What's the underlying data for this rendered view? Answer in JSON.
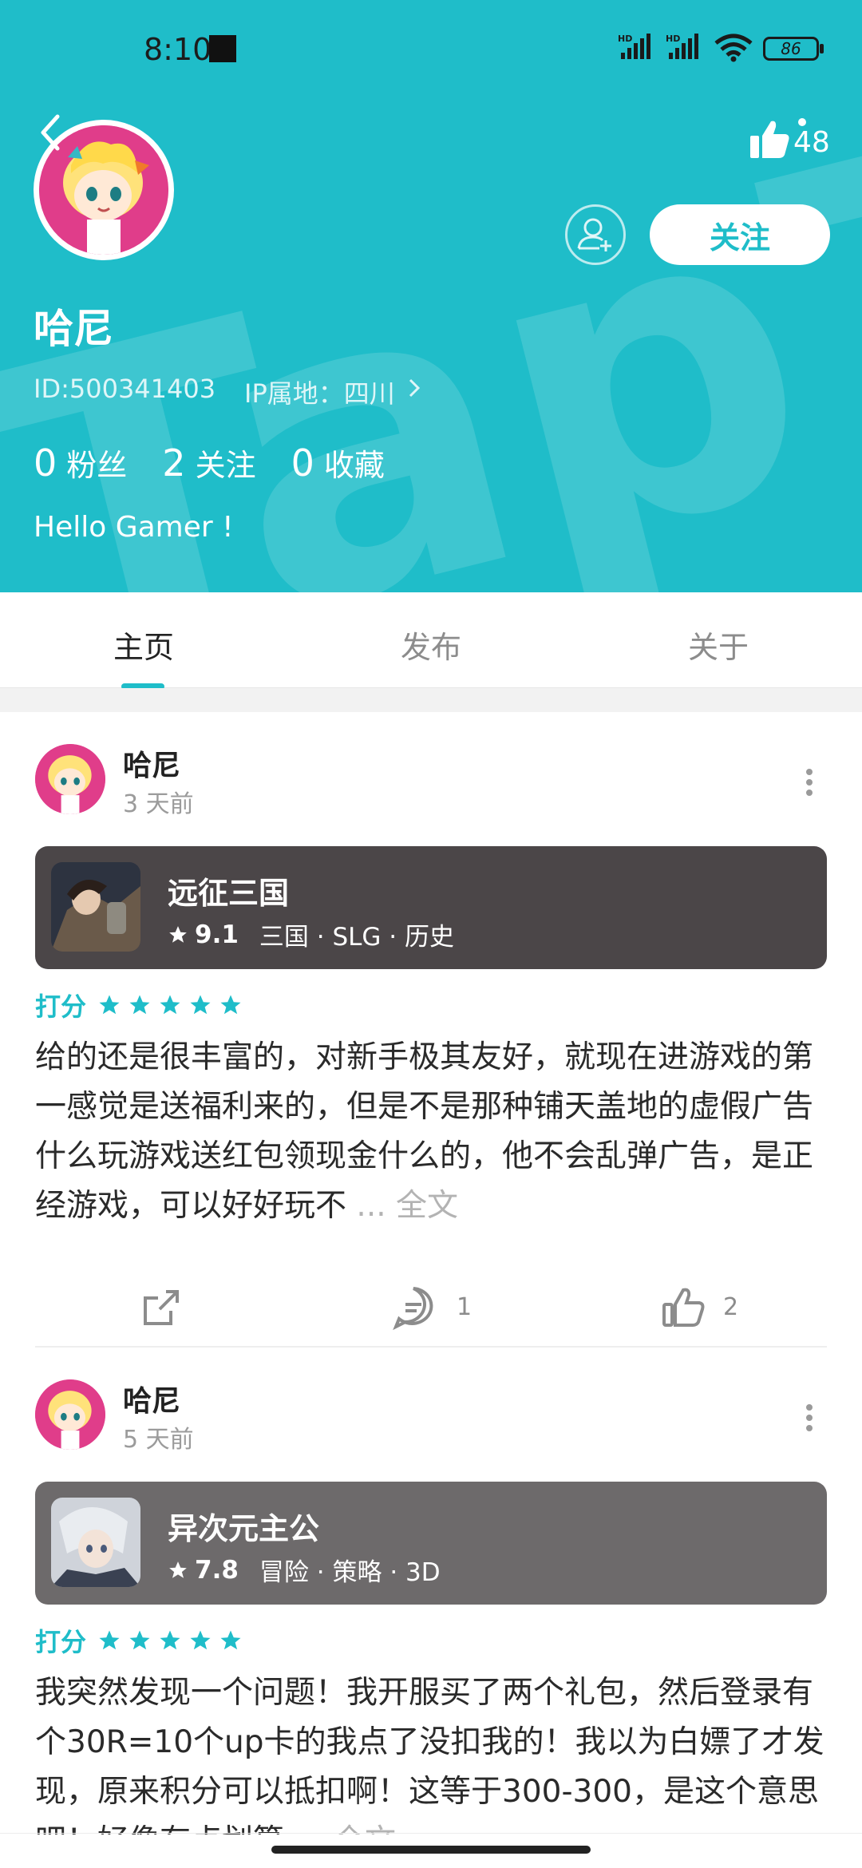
{
  "status_bar": {
    "time": "8:10",
    "network_1": "HD",
    "network_2": "HD",
    "battery": "86"
  },
  "header": {
    "bg_color": "#1fbdc9",
    "like_count": "48",
    "follow_label": "关注",
    "username": "哈尼",
    "user_id": "ID:500341403",
    "ip_location": "IP属地：四川",
    "stats": [
      {
        "num": "0",
        "label": "粉丝"
      },
      {
        "num": "2",
        "label": "关注"
      },
      {
        "num": "0",
        "label": "收藏"
      }
    ],
    "bio": "Hello Gamer !"
  },
  "tabs": [
    {
      "label": "主页",
      "active": true
    },
    {
      "label": "发布",
      "active": false
    },
    {
      "label": "关于",
      "active": false
    }
  ],
  "posts": [
    {
      "author": "哈尼",
      "time": "3 天前",
      "game": {
        "name": "远征三国",
        "score": "9.1",
        "tags": "三国 · SLG · 历史",
        "card_color": "#4b4648"
      },
      "rating_label": "打分",
      "stars": 5,
      "body": "给的还是很丰富的，对新手极其友好，就现在进游戏的第一感觉是送福利来的，但是不是那种铺天盖地的虚假广告什么玩游戏送红包领现金什么的，他不会乱弹广告，是正经游戏，可以好好玩不",
      "more": "... 全文",
      "comments": "1",
      "likes": "2"
    },
    {
      "author": "哈尼",
      "time": "5 天前",
      "game": {
        "name": "异次元主公",
        "score": "7.8",
        "tags": "冒险 · 策略 · 3D",
        "card_color": "#6d6a6b"
      },
      "rating_label": "打分",
      "stars": 5,
      "body": "我突然发现一个问题！我开服买了两个礼包，然后登录有个30R=10个up卡的我点了没扣我的！我以为白嫖了才发现，原来积分可以抵扣啊！这等于300-300，是这个意思吧！好像有点划算",
      "more": "... 全文"
    }
  ]
}
